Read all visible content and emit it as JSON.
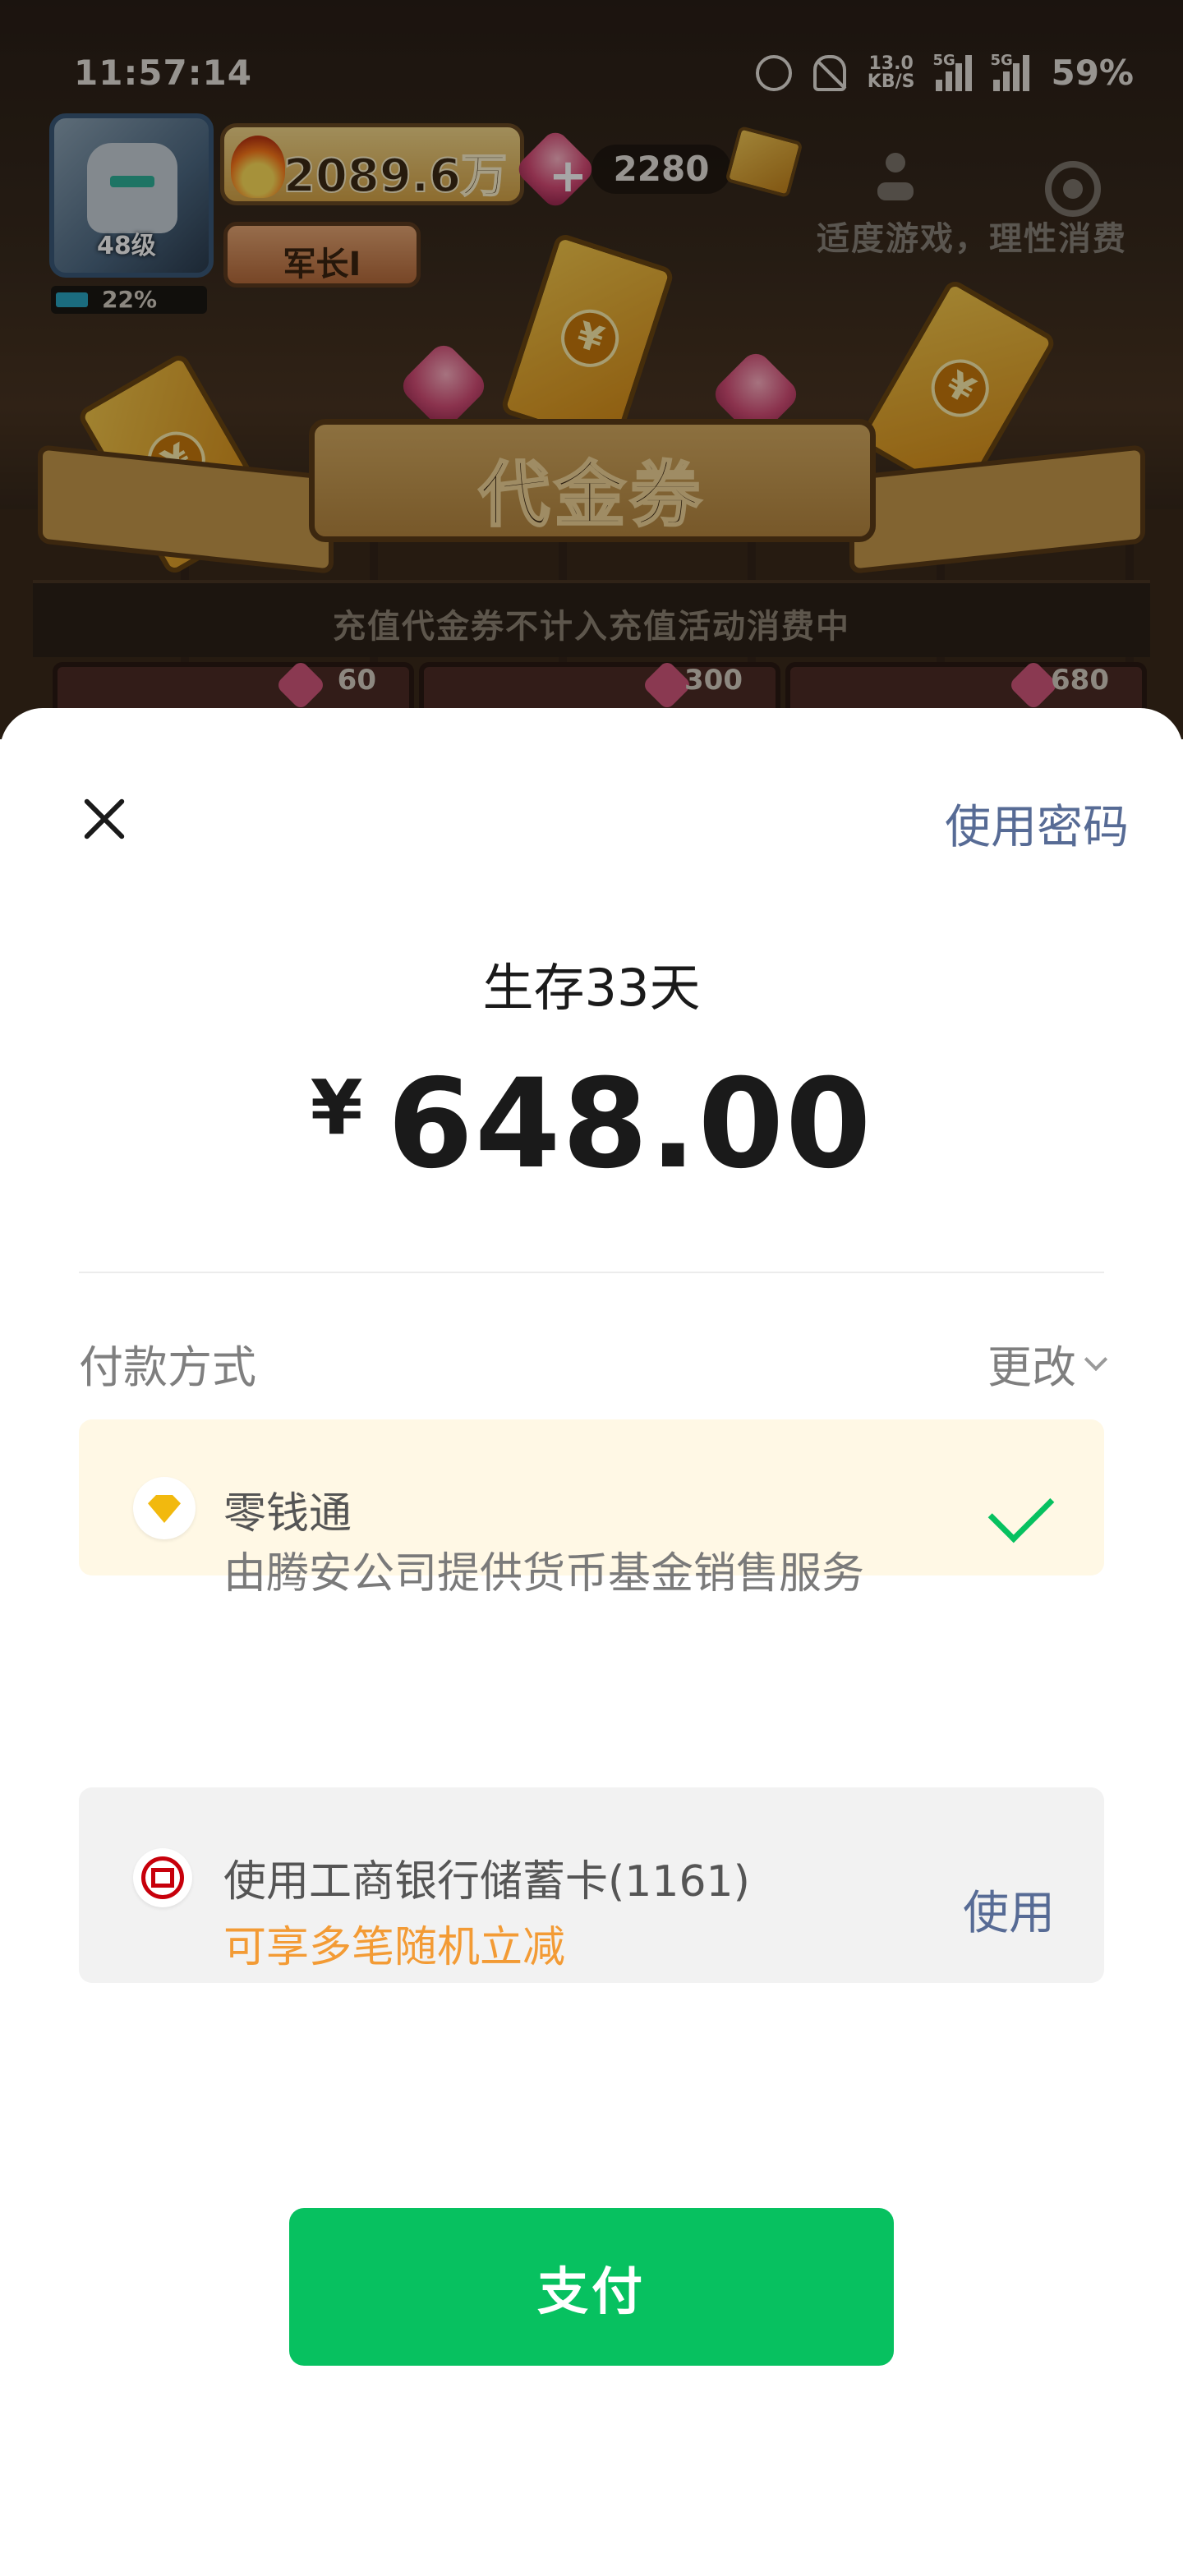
{
  "status_bar": {
    "time": "11:57:14",
    "net_speed": "13.0",
    "net_speed_unit": "KB/S",
    "signal1_tag": "5G",
    "signal2_tag": "5G",
    "battery": "59%"
  },
  "game": {
    "level": "48级",
    "xp_percent": "22%",
    "xp_fraction": 0.22,
    "power": "2089.6万",
    "rank": "军长Ⅰ",
    "gems": "2280",
    "moderate_notice": "适度游戏，理性消费",
    "banner_title": "代金券",
    "recharge_notice": "充值代金券不计入充值活动消费中",
    "shop_prices": [
      "60",
      "300",
      "680"
    ],
    "coupon_symbol": "¥"
  },
  "payment": {
    "use_password": "使用密码",
    "product_name": "生存33天",
    "currency": "¥",
    "amount": "648.00",
    "method_label": "付款方式",
    "change_label": "更改",
    "lqt": {
      "title": "零钱通",
      "description": "由腾安公司提供货币基金销售服务",
      "selected": true
    },
    "bank": {
      "title": "使用工商银行储蓄卡(1161)",
      "promo": "可享多笔随机立减",
      "action": "使用"
    },
    "pay_button": "支付"
  },
  "colors": {
    "wechat_green": "#07c160",
    "link_blue": "#576b95",
    "promo_orange": "#f39b35",
    "lqt_bg": "#fff8e5"
  }
}
